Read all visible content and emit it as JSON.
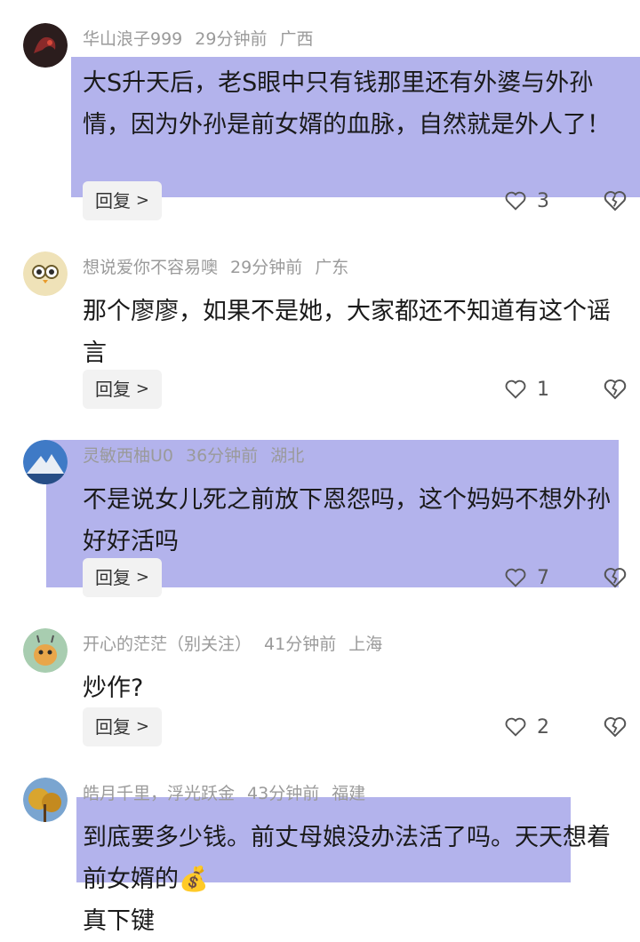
{
  "comments": [
    {
      "user": "华山浪子999",
      "time": "29分钟前",
      "location": "广西",
      "text": "大S升天后，老S眼中只有钱那里还有外婆与外孙情，因为外孙是前女婿的血脉，自然就是外人了！",
      "reply_label": "回复",
      "likes": "3",
      "avatar_color": "#3a2a2a"
    },
    {
      "user": "想说爱你不容易噢",
      "time": "29分钟前",
      "location": "广东",
      "text": "那个廖廖，如果不是她，大家都还不知道有这个谣言",
      "reply_label": "回复",
      "likes": "1",
      "avatar_color": "#e8d49a"
    },
    {
      "user": "灵敏西柚U0",
      "time": "36分钟前",
      "location": "湖北",
      "text": "不是说女儿死之前放下恩怨吗，这个妈妈不想外孙好好活吗",
      "reply_label": "回复",
      "likes": "7",
      "avatar_color": "#4a7fc0"
    },
    {
      "user": "开心的茫茫（别关注）",
      "time": "41分钟前",
      "location": "上海",
      "text": "炒作?",
      "reply_label": "回复",
      "likes": "2",
      "avatar_color": "#8fbf9a"
    },
    {
      "user": "皓月千里，浮光跃金",
      "time": "43分钟前",
      "location": "福建",
      "text": "到底要多少钱。前丈母娘没办法活了吗。天天想着前女婿的💰",
      "text2": "真下键",
      "avatar_color": "#c9a340"
    }
  ],
  "highlight_color": "#b3b3ec"
}
